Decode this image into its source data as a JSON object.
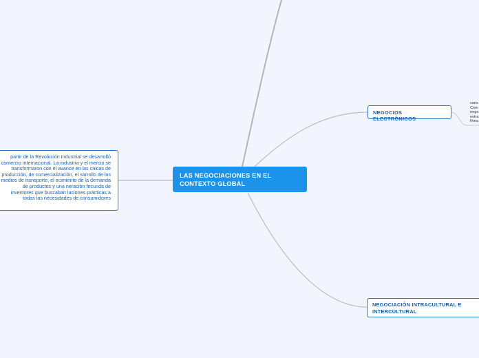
{
  "mindmap": {
    "central": {
      "label": "LAS NEGOCIACIONES EN EL CONTEXTO GLOBAL"
    },
    "left_node": {
      "text": "partir de la Revolución Industrial se desarrolló comercio internacional. La industria y el mercio se transformaron con el avance en las cnicas de producción, de comercialización, el sarrollo de los medios de transporte, el ecimiento de la demanda de productos y una neración fecunda de inventores que buscaban luciones prácticas a todas las necesidades de consumidores"
    },
    "negocios_electronicos": {
      "label": "NEGOCIOS ELECTRÓNICOS",
      "leaf_text": "cons\nCom\nnego\nestra\nlínea"
    },
    "negociacion_intracultural": {
      "label": "NEGOCIACIÓN INTRACULTURAL E INTERCULTURAL"
    },
    "colors": {
      "background": "#f2f5fd",
      "central_fill": "#1b93ea",
      "node_border": "#2b78c5",
      "node_text": "#1c5fae",
      "connector": "#b8bcc6"
    }
  }
}
